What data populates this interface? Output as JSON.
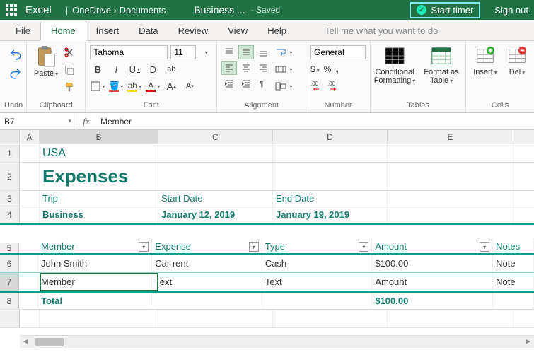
{
  "titlebar": {
    "app": "Excel",
    "crumb1": "OneDrive",
    "crumb2": "Documents",
    "doc": "Business ...",
    "status": "Saved",
    "start_timer": "Start timer",
    "signout": "Sign out"
  },
  "tabs": {
    "file": "File",
    "home": "Home",
    "insert": "Insert",
    "data": "Data",
    "review": "Review",
    "view": "View",
    "help": "Help",
    "tellme": "Tell me what you want to do"
  },
  "ribbon": {
    "undo_label": "Undo",
    "paste_label": "Paste",
    "clipboard_label": "Clipboard",
    "font_name": "Tahoma",
    "font_size": "11",
    "font_label": "Font",
    "alignment_label": "Alignment",
    "number_format": "General",
    "dollar": "$",
    "percent": "%",
    "number_label": "Number",
    "cond_fmt": "Conditional Formatting",
    "fmt_table": "Format as Table",
    "tables_label": "Tables",
    "insert_label": "Insert",
    "delete_label": "Del",
    "cells_label": "Cells"
  },
  "fx": {
    "cellref": "B7",
    "value": "Member"
  },
  "cols": {
    "A": "A",
    "B": "B",
    "C": "C",
    "D": "D",
    "E": "E"
  },
  "rows": {
    "r1": "1",
    "r2": "2",
    "r3": "3",
    "r4": "4",
    "r5": "5",
    "r6": "6",
    "r7": "7",
    "r8": "8"
  },
  "sheet": {
    "country": "USA",
    "title": "Expenses",
    "labels": {
      "trip": "Trip",
      "start": "Start Date",
      "end": "End Date"
    },
    "values": {
      "trip": "Business",
      "start": "January 12, 2019",
      "end": "January 19, 2019"
    },
    "headers": {
      "member": "Member",
      "expense": "Expense",
      "type": "Type",
      "amount": "Amount",
      "notes": "Notes"
    },
    "row1": {
      "member": "John Smith",
      "expense": "Car rent",
      "type": "Cash",
      "amount": "$100.00",
      "notes": "Note"
    },
    "row2": {
      "member": "Member",
      "expense": "Text",
      "type": "Text",
      "amount": "Amount",
      "notes": "Note"
    },
    "total": {
      "label": "Total",
      "amount": "$100.00"
    }
  }
}
